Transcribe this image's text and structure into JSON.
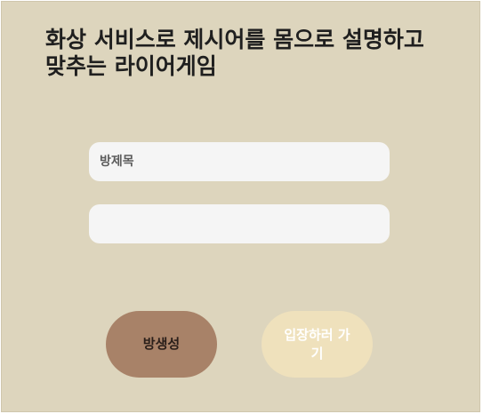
{
  "title": "화상 서비스로 제시어를 몸으로 설명하고 맞추는 라이어게임",
  "form": {
    "room_title_placeholder": "방제목",
    "second_field_placeholder": ""
  },
  "buttons": {
    "create_room": "방생성",
    "enter_room": "입장하러 가기"
  },
  "colors": {
    "background": "#ddd5bd",
    "input_background": "#f5f5f5",
    "create_button": "#a88268",
    "enter_button": "#efe1bc"
  }
}
